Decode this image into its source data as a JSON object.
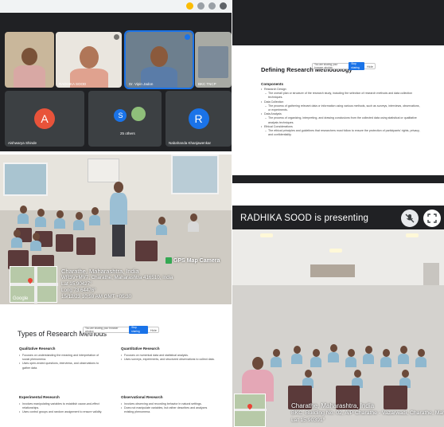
{
  "meet": {
    "participants": [
      {
        "name": "",
        "initial": ""
      },
      {
        "name": "RADHIKA SOOD",
        "initial": ""
      },
      {
        "name": "Dr. Vipin Jadon",
        "initial": ""
      },
      {
        "name": "BKC TNCP",
        "initial": ""
      },
      {
        "name": "Aishwarya Shinde",
        "initial": "A"
      },
      {
        "name": "25 others",
        "initial": "S"
      },
      {
        "name": "Nabahanda Khanjawenkar",
        "initial": "R"
      }
    ],
    "colors": {
      "avatar_a": "#e8533a",
      "avatar_s": "#1a73e8",
      "avatar_r": "#1a73e8",
      "active_mic": "#1a73e8"
    }
  },
  "slide_top": {
    "title": "Defining Research Methodology",
    "share_bar": {
      "text": "You are sharing your browser window",
      "stop": "Stop sharing",
      "hide": "Hide"
    },
    "section": "Components",
    "bullets": [
      {
        "text": "Research Design",
        "level": 0
      },
      {
        "text": "The overall plan or structure of the research study, including the selection of research methods and data collection techniques.",
        "level": 1
      },
      {
        "text": "Data Collection",
        "level": 0
      },
      {
        "text": "The process of gathering relevant data or information using various methods, such as surveys, interviews, observations, or experiments.",
        "level": 1
      },
      {
        "text": "Data Analysis",
        "level": 0
      },
      {
        "text": "The process of organizing, interpreting, and drawing conclusions from the collected data using statistical or qualitative analysis techniques.",
        "level": 1
      },
      {
        "text": "Ethical Considerations",
        "level": 0
      },
      {
        "text": "The ethical principles and guidelines that researchers must follow to ensure the protection of participants' rights, privacy, and confidentiality.",
        "level": 1
      }
    ]
  },
  "photo_left": {
    "badge": "GPS Map Camera",
    "place": "Charathe, Maharashtra, India",
    "address": "WR3V+MV7, Charathe, Maharashtra 416510, India",
    "lat": "Lat 15.90427°",
    "long": "Long 73.64476°",
    "datetime": "15/12/23 10:59 AM GMT +05:30",
    "map_label": "Google"
  },
  "slide_bottom": {
    "title": "Types of Research Methods",
    "share_bar": {
      "text": "You are sharing your browser window",
      "stop": "Stop sharing",
      "hide": "Hide"
    },
    "columns": [
      {
        "heading": "Qualitative Research",
        "bullets": [
          "Focuses on understanding the meaning and interpretation of social phenomena.",
          "Uses open-ended questions, interviews, and observations to gather data."
        ]
      },
      {
        "heading": "Quantitative Research",
        "bullets": [
          "Focuses on numerical data and statistical analysis.",
          "Uses surveys, experiments, and structured observations to collect data."
        ]
      },
      {
        "heading": "Experimental Research",
        "bullets": [
          "Involves manipulating variables to establish cause-and-effect relationships.",
          "Uses control groups and random assignment to ensure validity."
        ]
      },
      {
        "heading": "Observational Research",
        "bullets": [
          "Involves observing and recording behavior in natural settings.",
          "Does not manipulate variables, but rather describes and analyzes existing phenomena."
        ]
      }
    ]
  },
  "present": {
    "text": "RADHIKA SOOD is presenting",
    "icons": [
      "mic-off-icon",
      "fullscreen-icon"
    ]
  },
  "photo_right": {
    "place": "Charathe, Maharashtra, India",
    "address": "BKC, Building No. 02, A/P Charathe - Vazarwadi, Charathe, Mah",
    "lat": "Lat 15.90391°"
  }
}
